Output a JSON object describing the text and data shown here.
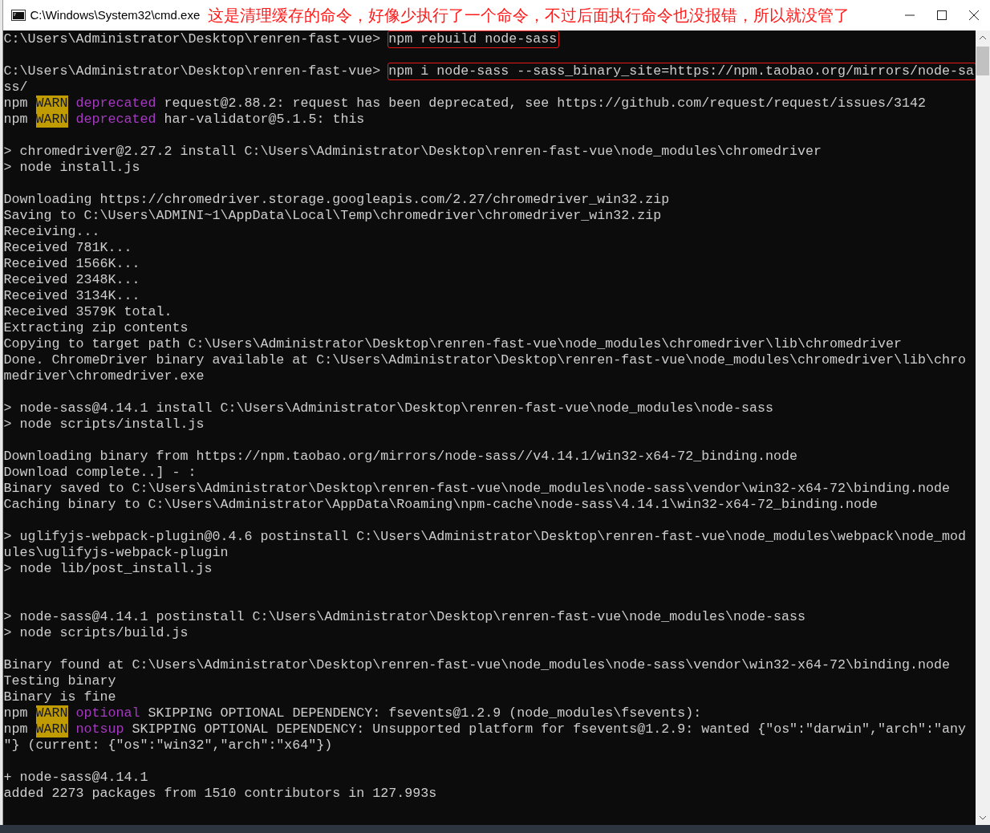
{
  "window": {
    "title": "C:\\Windows\\System32\\cmd.exe"
  },
  "annotation": "这是清理缓存的命令，好像少执行了一个命令，不过后面执行命令也没报错，所以就没管了",
  "console": {
    "lines": [
      {
        "kind": "text",
        "segments": [
          {
            "text": "C:\\Users\\Administrator\\Desktop\\renren-fast-vue>",
            "kind": "plain"
          },
          {
            "text": "npm rebuild node-sass",
            "kind": "command"
          }
        ]
      },
      {
        "kind": "blank"
      },
      {
        "kind": "text",
        "segments": [
          {
            "text": "C:\\Users\\Administrator\\Desktop\\renren-fast-vue>",
            "kind": "plain"
          },
          {
            "text": "npm i node-sass --sass_binary_site=https://npm.taobao.org/mirrors/node-sa",
            "kind": "command"
          }
        ]
      },
      {
        "kind": "text",
        "segments": [
          {
            "text": "ss/",
            "kind": "plain"
          }
        ]
      },
      {
        "kind": "text",
        "segments": [
          {
            "text": "npm",
            "kind": "plain"
          },
          {
            "text": "WARN",
            "kind": "warn"
          },
          {
            "text": "deprecated",
            "kind": "tag"
          },
          {
            "text": "request@2.88.2: request has been deprecated, see https://github.com/request/request/issues/3142",
            "kind": "plain"
          }
        ]
      },
      {
        "kind": "text",
        "segments": [
          {
            "text": "npm",
            "kind": "plain"
          },
          {
            "text": "WARN",
            "kind": "warn"
          },
          {
            "text": "deprecated",
            "kind": "tag"
          },
          {
            "text": "har-validator@5.1.5: this",
            "kind": "plain"
          }
        ]
      },
      {
        "kind": "blank"
      },
      {
        "kind": "text",
        "segments": [
          {
            "text": "> chromedriver@2.27.2 install C:\\Users\\Administrator\\Desktop\\renren-fast-vue\\node_modules\\chromedriver",
            "kind": "plain"
          }
        ]
      },
      {
        "kind": "text",
        "segments": [
          {
            "text": "> node install.js",
            "kind": "plain"
          }
        ]
      },
      {
        "kind": "blank"
      },
      {
        "kind": "text",
        "segments": [
          {
            "text": "Downloading https://chromedriver.storage.googleapis.com/2.27/chromedriver_win32.zip",
            "kind": "plain"
          }
        ]
      },
      {
        "kind": "text",
        "segments": [
          {
            "text": "Saving to C:\\Users\\ADMINI~1\\AppData\\Local\\Temp\\chromedriver\\chromedriver_win32.zip",
            "kind": "plain"
          }
        ]
      },
      {
        "kind": "text",
        "segments": [
          {
            "text": "Receiving...",
            "kind": "plain"
          }
        ]
      },
      {
        "kind": "text",
        "segments": [
          {
            "text": "Received 781K...",
            "kind": "plain"
          }
        ]
      },
      {
        "kind": "text",
        "segments": [
          {
            "text": "Received 1566K...",
            "kind": "plain"
          }
        ]
      },
      {
        "kind": "text",
        "segments": [
          {
            "text": "Received 2348K...",
            "kind": "plain"
          }
        ]
      },
      {
        "kind": "text",
        "segments": [
          {
            "text": "Received 3134K...",
            "kind": "plain"
          }
        ]
      },
      {
        "kind": "text",
        "segments": [
          {
            "text": "Received 3579K total.",
            "kind": "plain"
          }
        ]
      },
      {
        "kind": "text",
        "segments": [
          {
            "text": "Extracting zip contents",
            "kind": "plain"
          }
        ]
      },
      {
        "kind": "text",
        "segments": [
          {
            "text": "Copying to target path C:\\Users\\Administrator\\Desktop\\renren-fast-vue\\node_modules\\chromedriver\\lib\\chromedriver",
            "kind": "plain"
          }
        ]
      },
      {
        "kind": "text",
        "segments": [
          {
            "text": "Done. ChromeDriver binary available at C:\\Users\\Administrator\\Desktop\\renren-fast-vue\\node_modules\\chromedriver\\lib\\chro",
            "kind": "plain"
          }
        ]
      },
      {
        "kind": "text",
        "segments": [
          {
            "text": "medriver\\chromedriver.exe",
            "kind": "plain"
          }
        ]
      },
      {
        "kind": "blank"
      },
      {
        "kind": "text",
        "segments": [
          {
            "text": "> node-sass@4.14.1 install C:\\Users\\Administrator\\Desktop\\renren-fast-vue\\node_modules\\node-sass",
            "kind": "plain"
          }
        ]
      },
      {
        "kind": "text",
        "segments": [
          {
            "text": "> node scripts/install.js",
            "kind": "plain"
          }
        ]
      },
      {
        "kind": "blank"
      },
      {
        "kind": "text",
        "segments": [
          {
            "text": "Downloading binary from https://npm.taobao.org/mirrors/node-sass//v4.14.1/win32-x64-72_binding.node",
            "kind": "plain"
          }
        ]
      },
      {
        "kind": "text",
        "segments": [
          {
            "text": "Download complete..] - :",
            "kind": "plain"
          }
        ]
      },
      {
        "kind": "text",
        "segments": [
          {
            "text": "Binary saved to C:\\Users\\Administrator\\Desktop\\renren-fast-vue\\node_modules\\node-sass\\vendor\\win32-x64-72\\binding.node",
            "kind": "plain"
          }
        ]
      },
      {
        "kind": "text",
        "segments": [
          {
            "text": "Caching binary to C:\\Users\\Administrator\\AppData\\Roaming\\npm-cache\\node-sass\\4.14.1\\win32-x64-72_binding.node",
            "kind": "plain"
          }
        ]
      },
      {
        "kind": "blank"
      },
      {
        "kind": "text",
        "segments": [
          {
            "text": "> uglifyjs-webpack-plugin@0.4.6 postinstall C:\\Users\\Administrator\\Desktop\\renren-fast-vue\\node_modules\\webpack\\node_mod",
            "kind": "plain"
          }
        ]
      },
      {
        "kind": "text",
        "segments": [
          {
            "text": "ules\\uglifyjs-webpack-plugin",
            "kind": "plain"
          }
        ]
      },
      {
        "kind": "text",
        "segments": [
          {
            "text": "> node lib/post_install.js",
            "kind": "plain"
          }
        ]
      },
      {
        "kind": "blank"
      },
      {
        "kind": "blank"
      },
      {
        "kind": "text",
        "segments": [
          {
            "text": "> node-sass@4.14.1 postinstall C:\\Users\\Administrator\\Desktop\\renren-fast-vue\\node_modules\\node-sass",
            "kind": "plain"
          }
        ]
      },
      {
        "kind": "text",
        "segments": [
          {
            "text": "> node scripts/build.js",
            "kind": "plain"
          }
        ]
      },
      {
        "kind": "blank"
      },
      {
        "kind": "text",
        "segments": [
          {
            "text": "Binary found at C:\\Users\\Administrator\\Desktop\\renren-fast-vue\\node_modules\\node-sass\\vendor\\win32-x64-72\\binding.node",
            "kind": "plain"
          }
        ]
      },
      {
        "kind": "text",
        "segments": [
          {
            "text": "Testing binary",
            "kind": "plain"
          }
        ]
      },
      {
        "kind": "text",
        "segments": [
          {
            "text": "Binary is fine",
            "kind": "plain"
          }
        ]
      },
      {
        "kind": "text",
        "segments": [
          {
            "text": "npm",
            "kind": "plain"
          },
          {
            "text": "WARN",
            "kind": "warn"
          },
          {
            "text": "optional",
            "kind": "tag"
          },
          {
            "text": "SKIPPING OPTIONAL DEPENDENCY: fsevents@1.2.9 (node_modules\\fsevents):",
            "kind": "plain"
          }
        ]
      },
      {
        "kind": "text",
        "segments": [
          {
            "text": "npm",
            "kind": "plain"
          },
          {
            "text": "WARN",
            "kind": "warn"
          },
          {
            "text": "notsup",
            "kind": "tag"
          },
          {
            "text": "SKIPPING OPTIONAL DEPENDENCY: Unsupported platform for fsevents@1.2.9: wanted {\"os\":\"darwin\",\"arch\":\"any",
            "kind": "plain"
          }
        ]
      },
      {
        "kind": "text",
        "segments": [
          {
            "text": "\"} (current: {\"os\":\"win32\",\"arch\":\"x64\"})",
            "kind": "plain"
          }
        ]
      },
      {
        "kind": "blank"
      },
      {
        "kind": "text",
        "segments": [
          {
            "text": "+ node-sass@4.14.1",
            "kind": "plain"
          }
        ]
      },
      {
        "kind": "text",
        "segments": [
          {
            "text": "added 2273 packages from 1510 contributors in 127.993s",
            "kind": "plain"
          }
        ]
      }
    ]
  }
}
